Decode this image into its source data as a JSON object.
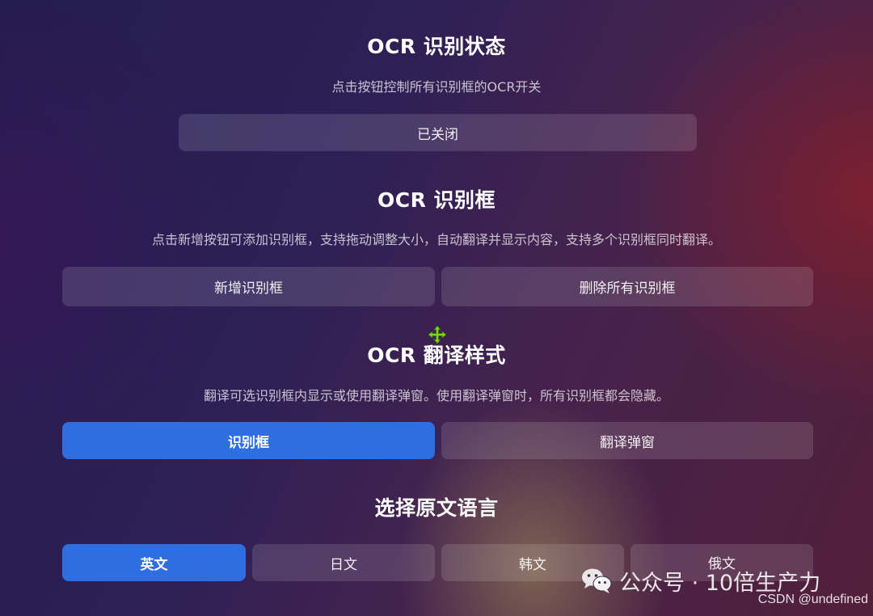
{
  "ocr_status": {
    "title": "OCR 识别状态",
    "description": "点击按钮控制所有识别框的OCR开关",
    "toggle_label": "已关闭"
  },
  "ocr_box": {
    "title": "OCR 识别框",
    "description": "点击新增按钮可添加识别框，支持拖动调整大小，自动翻译并显示内容，支持多个识别框同时翻译。",
    "add_label": "新增识别框",
    "delete_all_label": "删除所有识别框"
  },
  "ocr_style": {
    "title": "OCR 翻译样式",
    "description": "翻译可选识别框内显示或使用翻译弹窗。使用翻译弹窗时，所有识别框都会隐藏。",
    "options": [
      {
        "label": "识别框",
        "selected": true
      },
      {
        "label": "翻译弹窗",
        "selected": false
      }
    ]
  },
  "source_language": {
    "title": "选择原文语言",
    "options": [
      {
        "label": "英文",
        "selected": true
      },
      {
        "label": "日文",
        "selected": false
      },
      {
        "label": "韩文",
        "selected": false
      },
      {
        "label": "俄文",
        "selected": false
      }
    ]
  },
  "watermark": {
    "text": "公众号 · 10倍生产力",
    "icon": "wechat-icon"
  },
  "csdn_watermark": "CSDN @undefined",
  "colors": {
    "accent": "#2f6ee0",
    "cursor": "#7ed321"
  }
}
